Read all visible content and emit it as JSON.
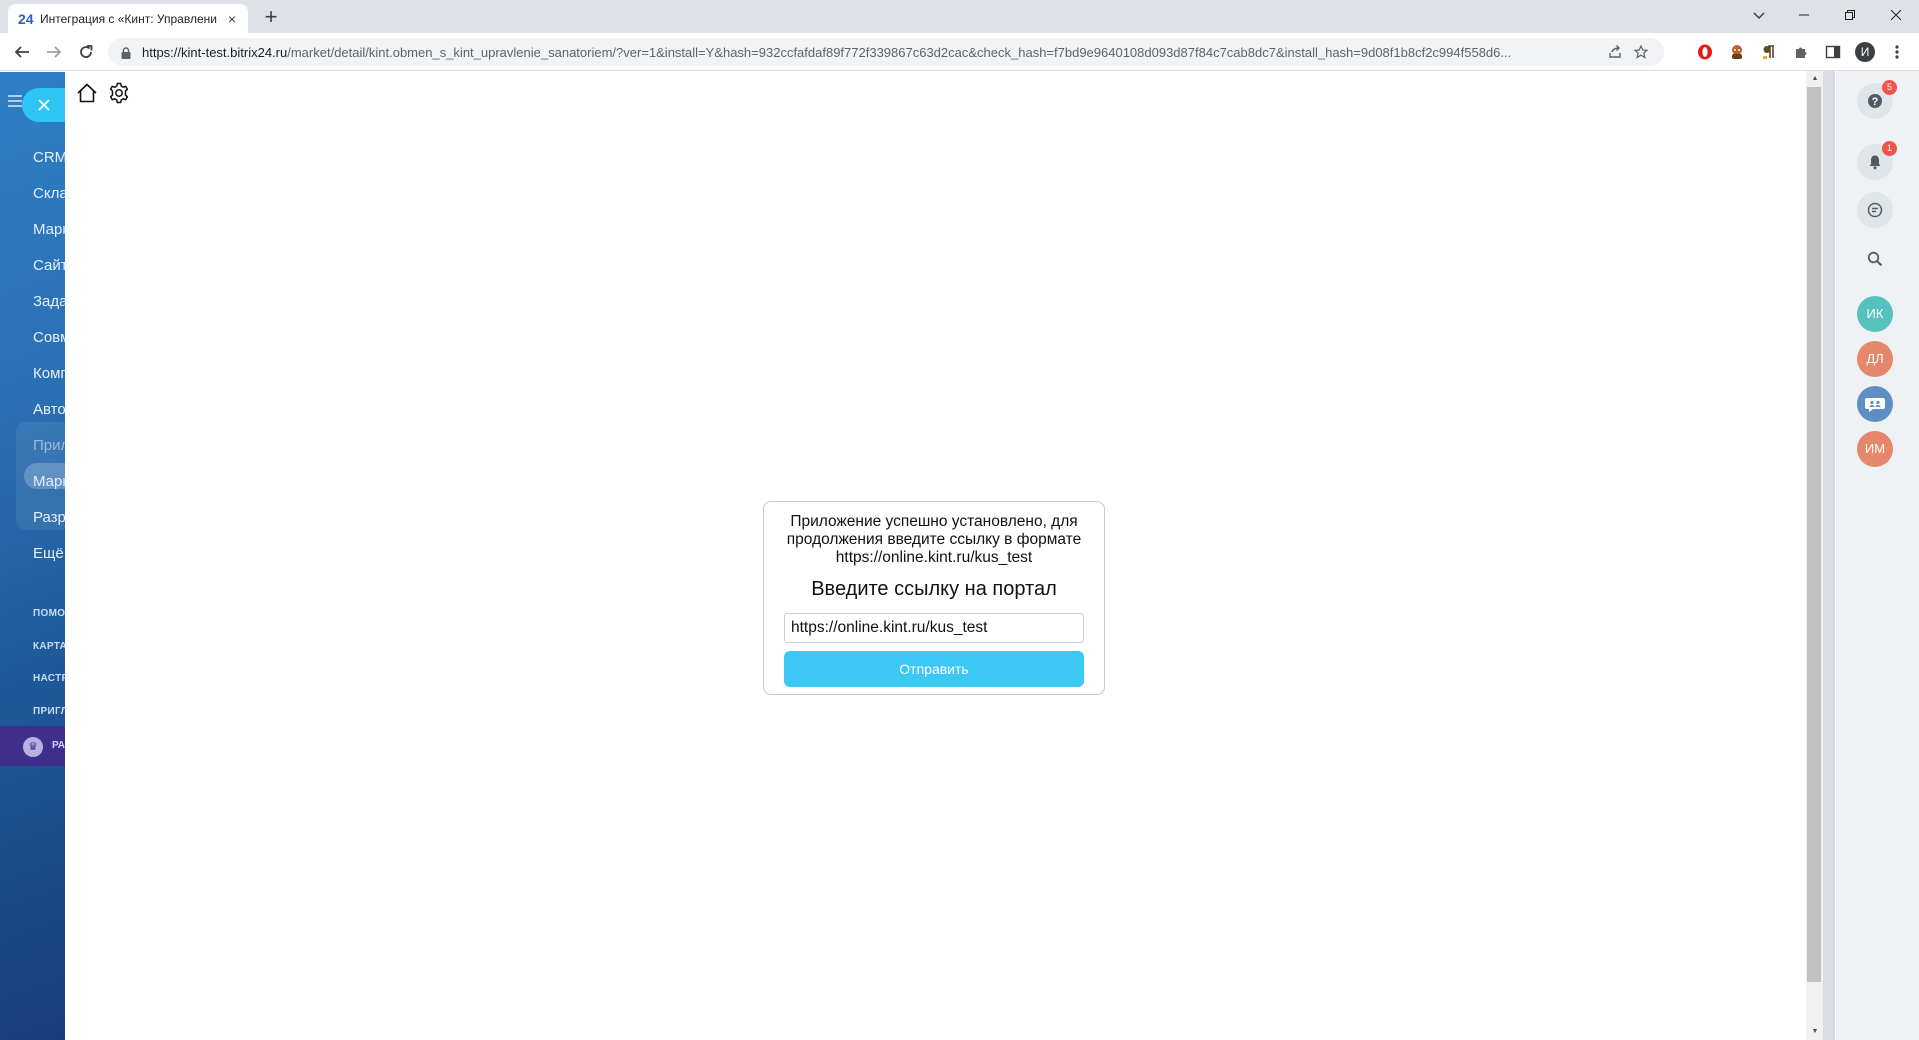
{
  "browser": {
    "tab_favicon": "24",
    "tab_title": "Интеграция с «Кинт: Управлени",
    "tab_close": "×",
    "new_tab": "+",
    "url_host": "https://kint-test.bitrix24.ru",
    "url_rest": "/market/detail/kint.obmen_s_kint_upravlenie_sanatoriem/?ver=1&install=Y&hash=932ccfafdaf89f772f339867c63d2cac&check_hash=f7bd9e9640108d093d87f84c7cab8dc7&install_hash=9d08f1b8cf2c994f558d6...",
    "profile_initial": "И"
  },
  "left_menu": {
    "items": [
      "CRM",
      "Склад",
      "Маркетинг",
      "Сайты",
      "Задачи",
      "Совместная",
      "Компания",
      "Автоматизация"
    ],
    "group_items": [
      "Приложения",
      "Маркет",
      "Разработчикам"
    ],
    "more": "Ещё",
    "small_items": [
      "ПОМОЩЬ",
      "КАРТА",
      "НАСТРОИТЬ",
      "ПРИГЛАСИТЬ"
    ],
    "tariff_label": "РАСШИРИТЬ"
  },
  "app": {
    "message": "Приложение успешно установлено, для продолжения введите ссылку в формате https://online.kint.ru/kus_test",
    "title": "Введите ссылку на портал",
    "input_value": "https://online.kint.ru/kus_test",
    "submit_label": "Отправить"
  },
  "right_panel": {
    "help_badge": "5",
    "notifications_badge": "1",
    "avatars": [
      {
        "initials": "ИК",
        "color": "#55c2be"
      },
      {
        "initials": "ДЛ",
        "color": "#e5876b"
      },
      {
        "initials": "ИМ",
        "color": "#e5876b"
      }
    ],
    "group_chat_color": "#5d8fc4"
  }
}
